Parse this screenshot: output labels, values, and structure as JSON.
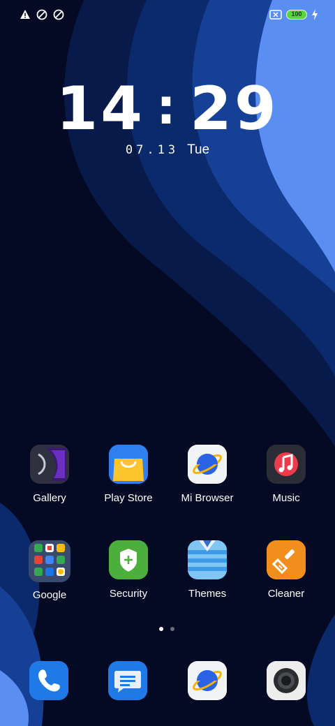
{
  "status_bar": {
    "battery_level": "100",
    "icons_left": [
      "warning-icon",
      "data-saver-icon",
      "data-saver-icon"
    ],
    "icons_right": [
      "no-sim-icon",
      "battery-icon",
      "charging-icon"
    ]
  },
  "clock": {
    "hours": "14",
    "minutes": "29",
    "separator": ":",
    "date": "07.13",
    "weekday": "Tue"
  },
  "home_apps": [
    {
      "label": "Gallery",
      "icon": "gallery-icon"
    },
    {
      "label": "Play Store",
      "icon": "play-store-icon"
    },
    {
      "label": "Mi Browser",
      "icon": "browser-icon"
    },
    {
      "label": "Music",
      "icon": "music-icon"
    },
    {
      "label": "Google",
      "icon": "google-folder-icon"
    },
    {
      "label": "Security",
      "icon": "security-icon"
    },
    {
      "label": "Themes",
      "icon": "themes-icon"
    },
    {
      "label": "Cleaner",
      "icon": "cleaner-icon"
    }
  ],
  "page_indicator": {
    "current": 1,
    "total": 2
  },
  "dock": [
    {
      "icon": "phone-icon"
    },
    {
      "icon": "messages-icon"
    },
    {
      "icon": "browser-icon"
    },
    {
      "icon": "camera-icon"
    }
  ],
  "colors": {
    "wallpaper_dark": "#040a24",
    "wallpaper_mid": "#0b2a6b",
    "wallpaper_light": "#5a8ef0",
    "battery_green": "#5cd33b"
  }
}
